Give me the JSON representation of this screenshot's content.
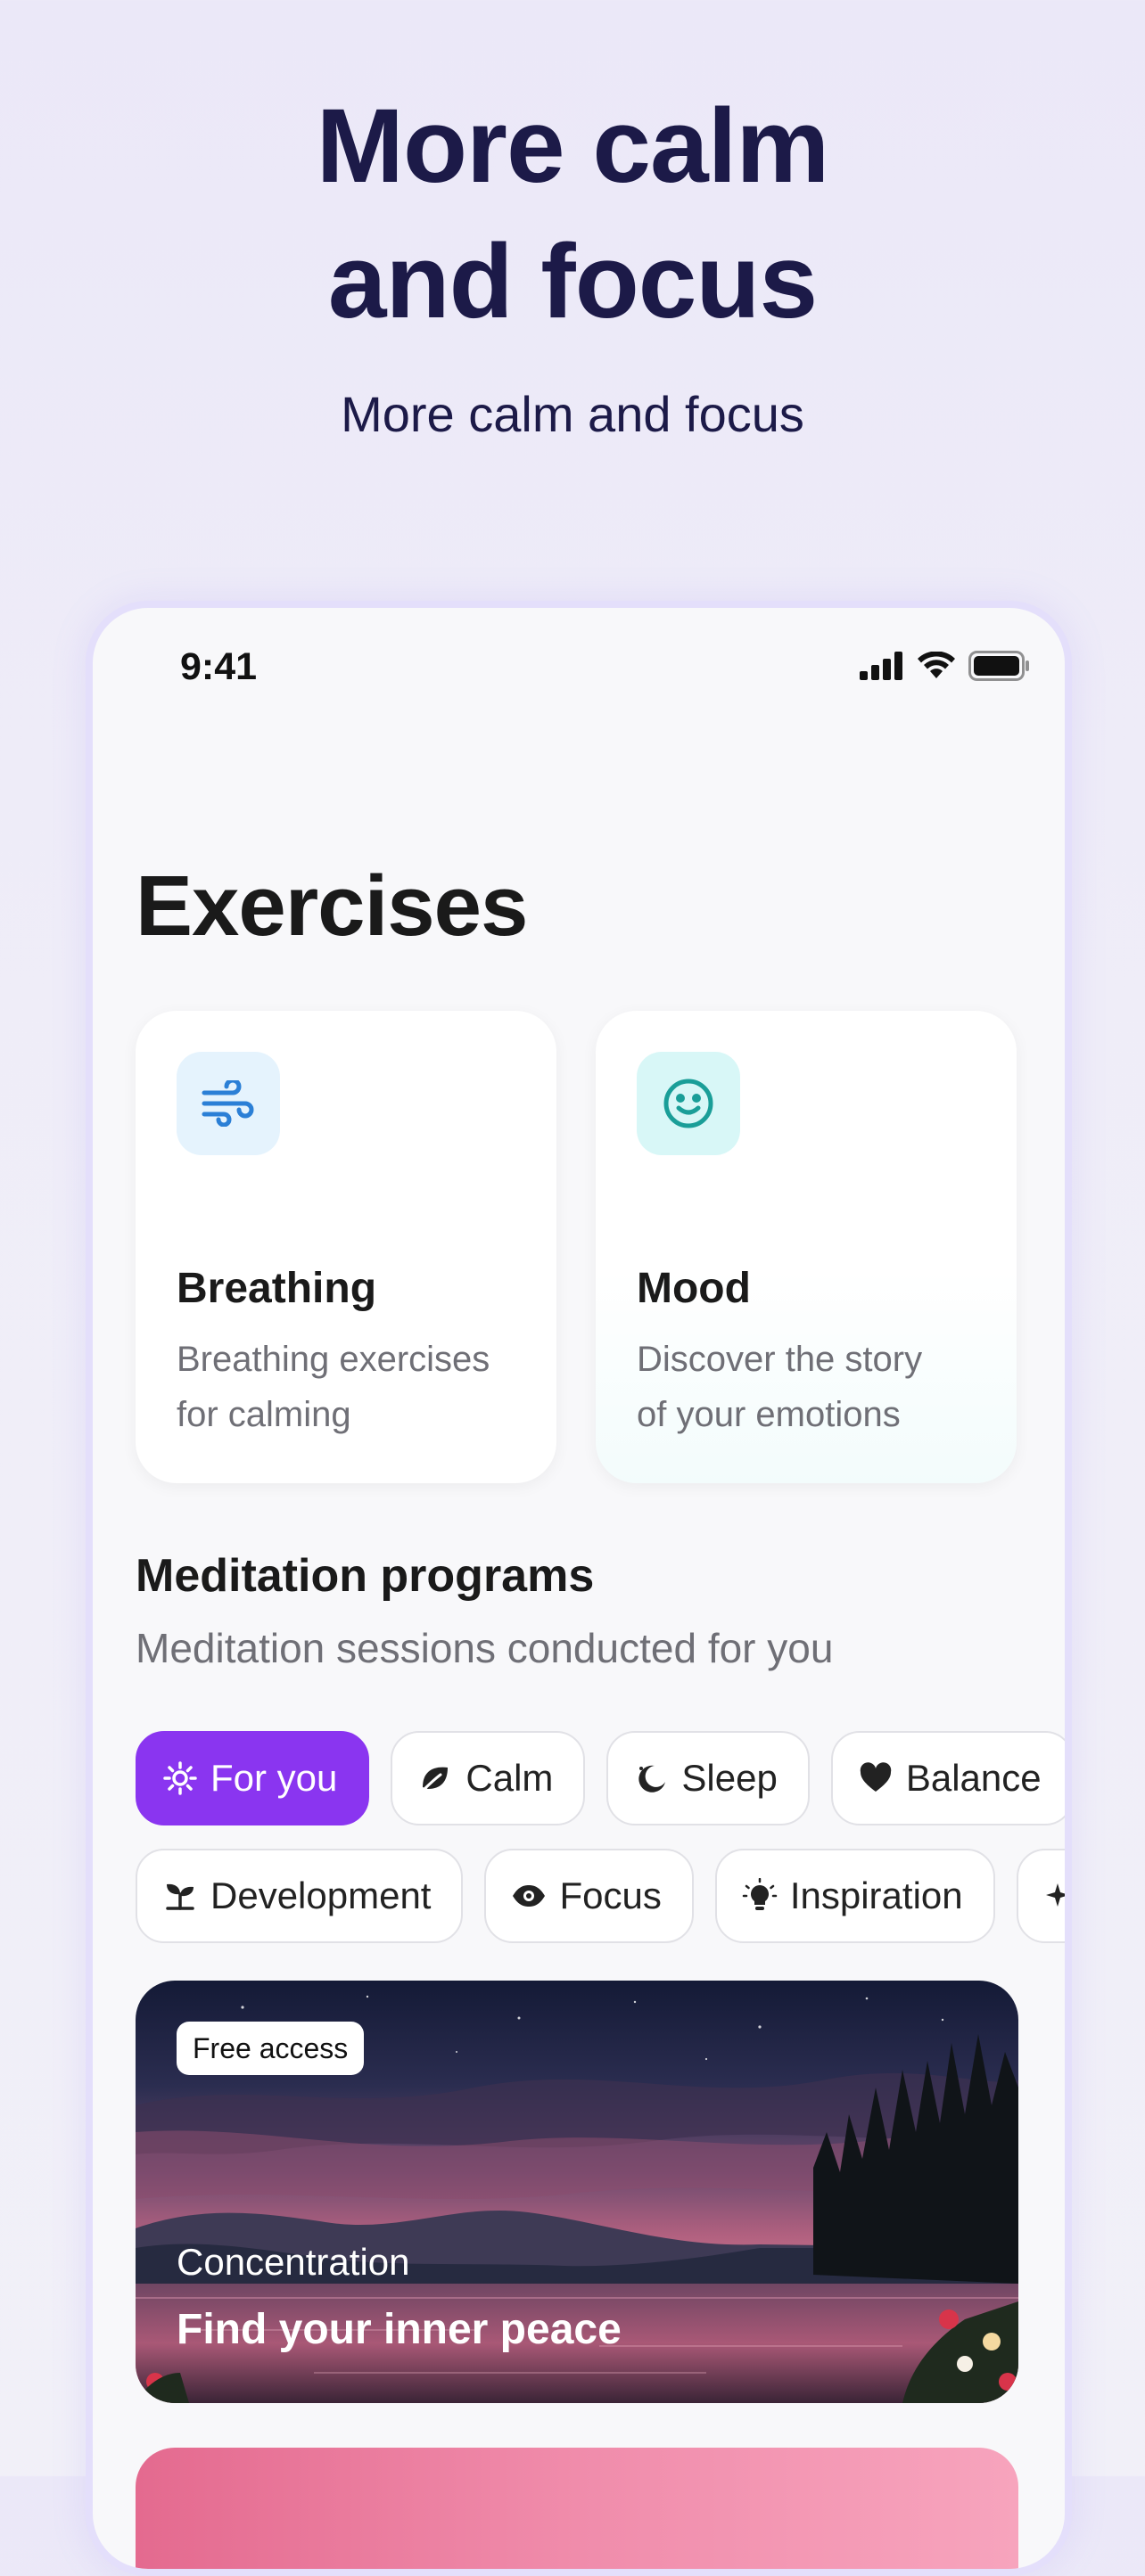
{
  "hero": {
    "title_line1": "More calm",
    "title_line2": "and focus",
    "subtitle": "More calm and focus"
  },
  "status_bar": {
    "time": "9:41",
    "icons": [
      "cellular-signal-icon",
      "wifi-icon",
      "battery-icon"
    ]
  },
  "page": {
    "title": "Exercises"
  },
  "cards": [
    {
      "icon": "wind-icon",
      "title": "Breathing",
      "desc_line1": "Breathing exercises",
      "desc_line2": "for calming",
      "icon_color": "#2b7fd6"
    },
    {
      "icon": "smiley-icon",
      "title": "Mood",
      "desc_line1": "Discover the story",
      "desc_line2": "of your emotions",
      "icon_color": "#1a9e98"
    }
  ],
  "section": {
    "title": "Meditation programs",
    "subtitle": "Meditation sessions conducted for you"
  },
  "chips_row1": [
    {
      "icon": "sun-icon",
      "label": "For you",
      "active": true
    },
    {
      "icon": "leaf-icon",
      "label": "Calm",
      "active": false
    },
    {
      "icon": "moon-icon",
      "label": "Sleep",
      "active": false
    },
    {
      "icon": "heart-icon",
      "label": "Balance",
      "active": false
    }
  ],
  "chips_row2": [
    {
      "icon": "sprout-icon",
      "label": "Development"
    },
    {
      "icon": "eye-icon",
      "label": "Focus"
    },
    {
      "icon": "lightbulb-icon",
      "label": "Inspiration"
    },
    {
      "icon": "sparkle-icon",
      "label": ""
    }
  ],
  "banner": {
    "badge": "Free access",
    "category": "Concentration",
    "title": "Find your inner peace"
  },
  "colors": {
    "accent": "#8a35f0",
    "heading": "#1c1a48",
    "text_secondary": "#6f6f76"
  }
}
